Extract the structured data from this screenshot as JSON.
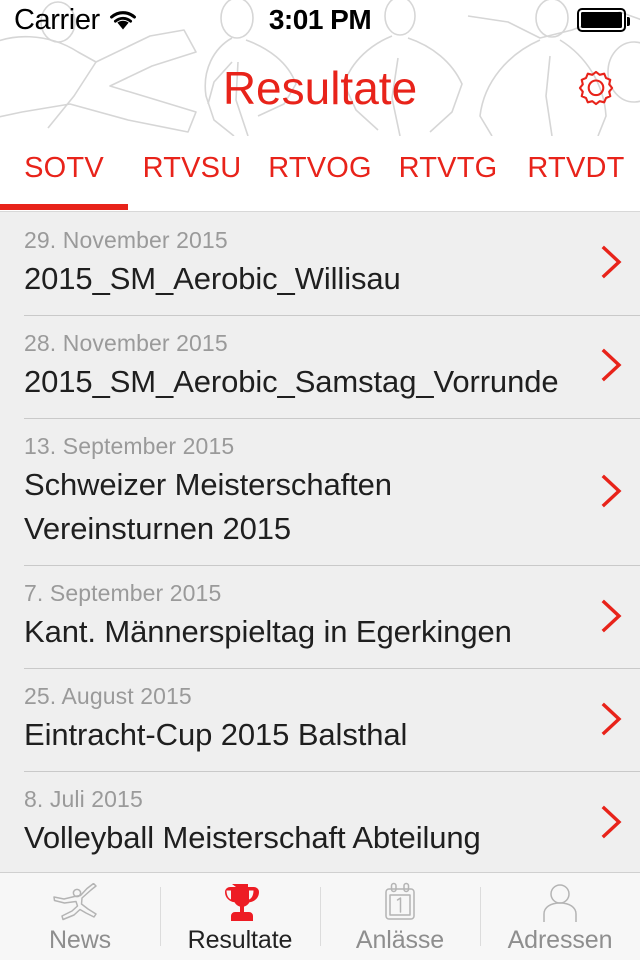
{
  "status_bar": {
    "carrier": "Carrier",
    "wifi_icon": "wifi-icon",
    "time": "3:01 PM",
    "battery_icon": "battery-full-icon"
  },
  "header": {
    "title": "Resultate",
    "settings_icon": "gear-icon",
    "title_color": "#e8231a",
    "background_pattern": "gymnast-outline-watermark"
  },
  "segments": {
    "active_index": 0,
    "tabs": [
      {
        "label": "SOTV"
      },
      {
        "label": "RTVSU"
      },
      {
        "label": "RTVOG"
      },
      {
        "label": "RTVTG"
      },
      {
        "label": "RTVDT"
      }
    ]
  },
  "list": {
    "chevron_icon": "chevron-right-icon",
    "rows": [
      {
        "date": "29. November 2015",
        "title": "2015_SM_Aerobic_Willisau"
      },
      {
        "date": "28. November 2015",
        "title": "2015_SM_Aerobic_Samstag_Vorrunde"
      },
      {
        "date": "13. September 2015",
        "title": "Schweizer Meisterschaften Vereinsturnen 2015"
      },
      {
        "date": "7. September 2015",
        "title": "Kant. Männerspieltag in Egerkingen"
      },
      {
        "date": "25. August 2015",
        "title": "Eintracht-Cup 2015 Balsthal"
      },
      {
        "date": "8. Juli 2015",
        "title": "Volleyball Meisterschaft Abteilung"
      }
    ]
  },
  "tab_bar": {
    "active_index": 1,
    "items": [
      {
        "label": "News",
        "icon": "gymnast-icon"
      },
      {
        "label": "Resultate",
        "icon": "trophy-icon"
      },
      {
        "label": "Anlässe",
        "icon": "calendar-icon",
        "calendar_day": "1"
      },
      {
        "label": "Adressen",
        "icon": "person-icon"
      }
    ]
  },
  "colors": {
    "accent": "#e8231a",
    "list_background": "#efefef",
    "muted_text": "#9a9a9a"
  }
}
